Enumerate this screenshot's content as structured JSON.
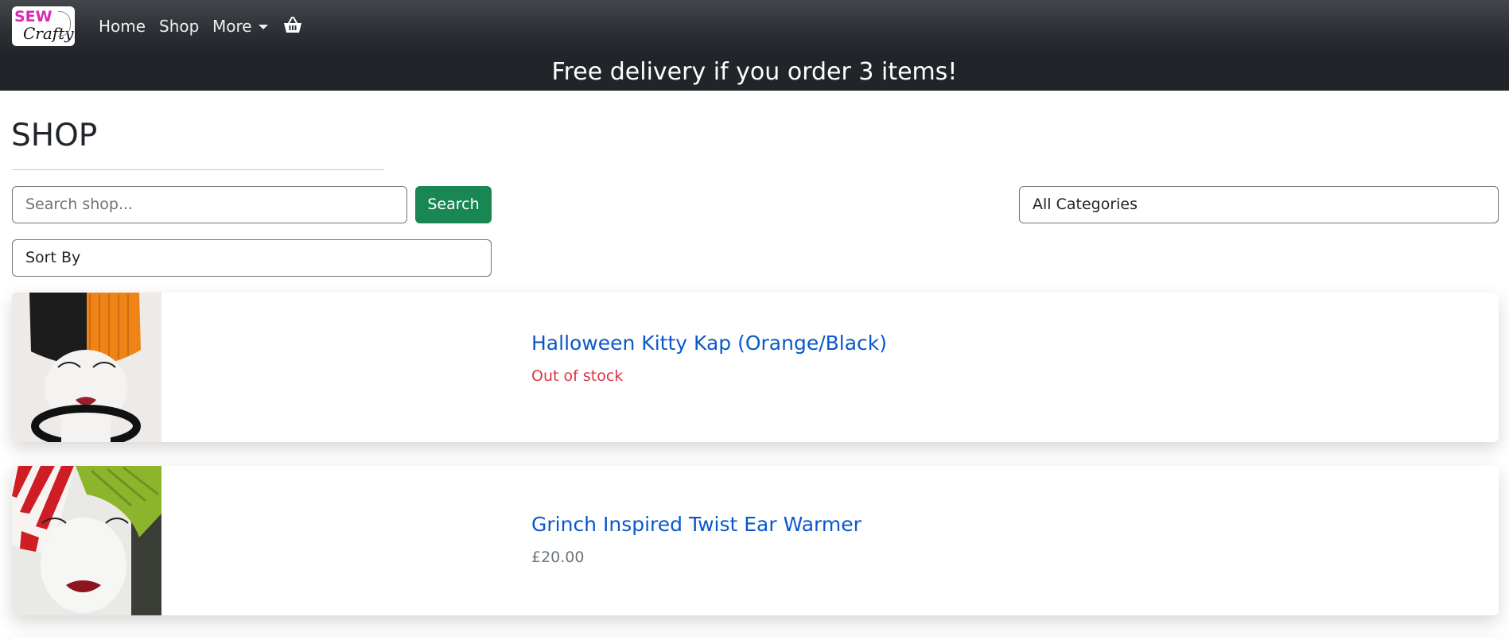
{
  "navbar": {
    "logo": {
      "line1": "SEW",
      "line2": "Crafty"
    },
    "links": {
      "home": "Home",
      "shop": "Shop",
      "more": "More"
    },
    "basket_icon": "basket-icon",
    "promo_text": "Free delivery if you order 3 items!"
  },
  "page": {
    "title": "SHOP"
  },
  "search": {
    "placeholder": "Search shop...",
    "button_label": "Search"
  },
  "filters": {
    "category_selected": "All Categories",
    "sort_selected": "Sort By"
  },
  "products": [
    {
      "name": "Halloween Kitty Kap (Orange/Black)",
      "status": "Out of stock",
      "status_color": "#dc3545",
      "image_icon": "hat-on-mannequin-image"
    },
    {
      "name": "Grinch Inspired Twist Ear Warmer",
      "price": "£20.00",
      "image_icon": "ear-warmer-on-mannequin-image"
    }
  ],
  "colors": {
    "navbar_bg": "#212529",
    "search_button": "#198754",
    "link": "#0a58ca",
    "out_of_stock": "#dc3545"
  }
}
